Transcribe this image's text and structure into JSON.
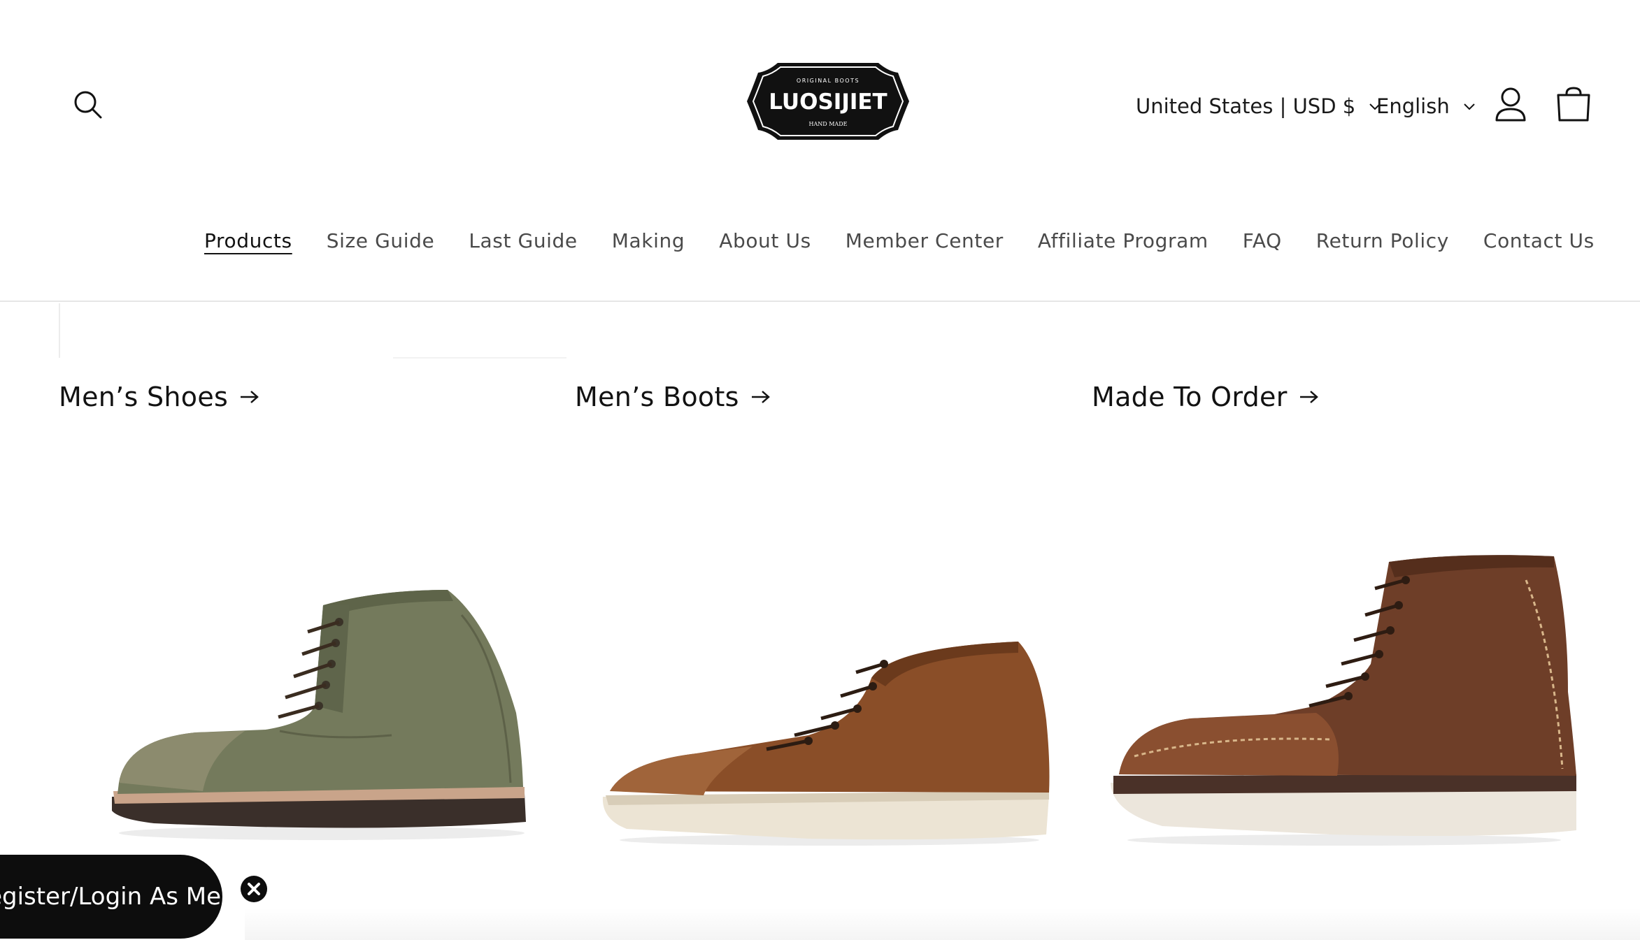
{
  "header": {
    "logo_top": "ORIGINAL BOOTS",
    "logo_main": "LUOSIJIET",
    "logo_bottom": "HAND MADE",
    "region_label": "United States | USD $",
    "language_label": "English"
  },
  "nav": {
    "items": [
      {
        "label": "Products"
      },
      {
        "label": "Size Guide"
      },
      {
        "label": "Last Guide"
      },
      {
        "label": "Making"
      },
      {
        "label": "About Us"
      },
      {
        "label": "Member Center"
      },
      {
        "label": "Affiliate Program"
      },
      {
        "label": "FAQ"
      },
      {
        "label": "Return Policy"
      },
      {
        "label": "Contact Us"
      }
    ]
  },
  "collections": [
    {
      "label": "Men’s Shoes",
      "product_color": "olive-green suede"
    },
    {
      "label": "Men’s Boots",
      "product_color": "brown leather"
    },
    {
      "label": "Made To Order",
      "product_color": "dark brown leather"
    }
  ],
  "member_bar": {
    "label": "Register/Login As Member"
  },
  "colors": {
    "text": "#121212",
    "nav_text": "#4a4a4a",
    "member_bar_bg": "#0d0d0d"
  }
}
